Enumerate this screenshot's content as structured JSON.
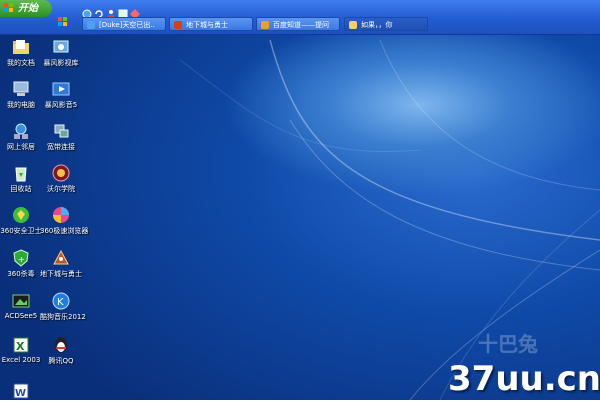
{
  "taskbar": {
    "start_label": "开始",
    "quick_launch": [
      "ie-icon",
      "refresh-icon",
      "user-icon",
      "media-icon",
      "app-icon"
    ],
    "tasks": [
      {
        "label": "[Duke]天空已出..",
        "icon": "ie-icon",
        "active": false
      },
      {
        "label": "地下城与勇士",
        "icon": "game-icon",
        "active": false
      },
      {
        "label": "百度知道——提问",
        "icon": "baidu-icon",
        "active": false
      },
      {
        "label": "如果，，你",
        "icon": "folder-icon",
        "active": true
      }
    ]
  },
  "desktop": {
    "icons": [
      {
        "label": "我的文档",
        "icon": "folder-documents-icon"
      },
      {
        "label": "暴风影视库",
        "icon": "video-library-icon"
      },
      {
        "label": "我的电脑",
        "icon": "my-computer-icon"
      },
      {
        "label": "暴风影音5",
        "icon": "media-player-icon"
      },
      {
        "label": "网上邻居",
        "icon": "network-icon"
      },
      {
        "label": "宽带连接",
        "icon": "broadband-icon"
      },
      {
        "label": "回收站",
        "icon": "recycle-bin-icon"
      },
      {
        "label": "沃尔学院",
        "icon": "academy-icon"
      },
      {
        "label": "360安全卫士",
        "icon": "security-guard-icon"
      },
      {
        "label": "360极速浏览器",
        "icon": "browser-icon"
      },
      {
        "label": "360杀毒",
        "icon": "antivirus-icon"
      },
      {
        "label": "地下城与勇士",
        "icon": "game-icon"
      },
      {
        "label": "ACDSee5",
        "icon": "image-viewer-icon"
      },
      {
        "label": "酷狗音乐2012",
        "icon": "music-icon"
      },
      {
        "label": "Excel 2003",
        "icon": "excel-icon"
      },
      {
        "label": "腾讯QQ",
        "icon": "qq-icon"
      },
      {
        "label": "",
        "icon": "word-icon"
      }
    ]
  },
  "watermark": {
    "text": "37uu.cn",
    "faint_text": "十巴兔"
  },
  "colors": {
    "taskbar": "#2a63d6",
    "start": "#3a9a2c",
    "desktop": "#0f4aa9"
  }
}
